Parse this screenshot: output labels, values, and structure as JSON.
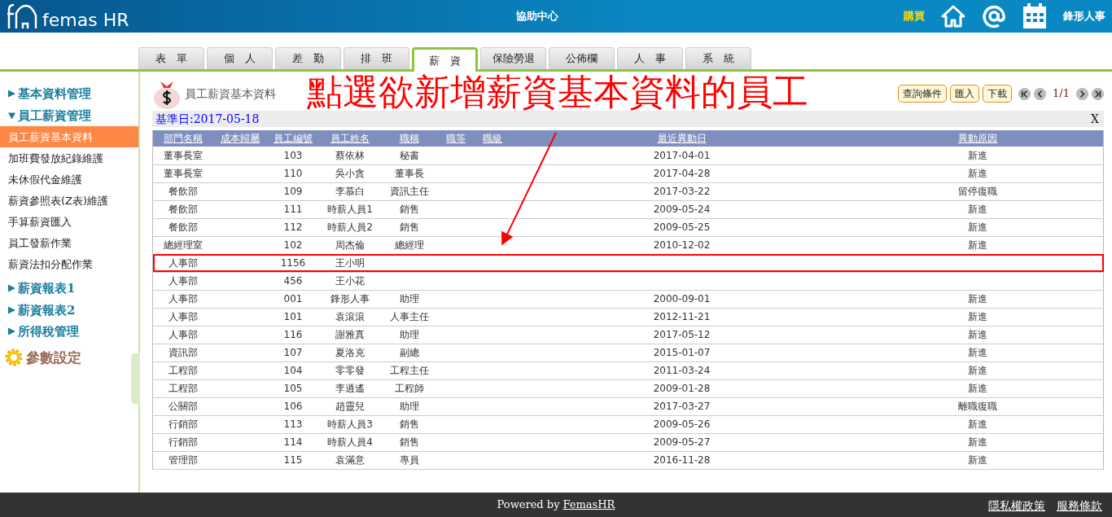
{
  "header": {
    "brand": "femas HR",
    "help": "協助中心",
    "buy": "購買",
    "user": "鋒形人事"
  },
  "tabs": [
    {
      "label": "表　單",
      "selected": false
    },
    {
      "label": "個　人",
      "selected": false
    },
    {
      "label": "差　勤",
      "selected": false
    },
    {
      "label": "排　班",
      "selected": false
    },
    {
      "label": "薪　資",
      "selected": true
    },
    {
      "label": "保險勞退",
      "selected": false
    },
    {
      "label": "公佈欄",
      "selected": false
    },
    {
      "label": "人　事",
      "selected": false
    },
    {
      "label": "系　統",
      "selected": false
    }
  ],
  "sidebar": {
    "sections": [
      {
        "label": "基本資料管理",
        "kind": "group",
        "expanded": false
      },
      {
        "label": "員工薪資管理",
        "kind": "group",
        "expanded": true,
        "items": [
          {
            "label": "員工薪資基本資料",
            "selected": true
          },
          {
            "label": "加班費發放紀錄維護",
            "selected": false
          },
          {
            "label": "未休假代金維護",
            "selected": false
          },
          {
            "label": "薪資參照表(Z表)維護",
            "selected": false
          },
          {
            "label": "手算薪資匯入",
            "selected": false
          },
          {
            "label": "員工發薪作業",
            "selected": false
          },
          {
            "label": "薪資法扣分配作業",
            "selected": false
          }
        ]
      },
      {
        "label": "薪資報表1",
        "kind": "group",
        "expanded": false
      },
      {
        "label": "薪資報表2",
        "kind": "group",
        "expanded": false
      },
      {
        "label": "所得稅管理",
        "kind": "group",
        "expanded": false
      },
      {
        "label": "參數設定",
        "kind": "settings"
      }
    ]
  },
  "page": {
    "title": "員工薪資基本資料",
    "annotation": "點選欲新增薪資基本資料的員工",
    "base_date_label": "基準日",
    "base_date": ":2017-05-18",
    "buttons": [
      "查詢條件",
      "匯入",
      "下載"
    ],
    "pager": "1/1",
    "close": "X"
  },
  "table": {
    "columns": [
      "部門名稱",
      "成本歸屬",
      "員工編號",
      "員工姓名",
      "職稱",
      "職等",
      "職級",
      "最近異動日",
      "異動原因"
    ],
    "rows": [
      {
        "cells": [
          "董事長室",
          "",
          "103",
          "蔡依林",
          "秘書",
          "",
          "",
          "2017-04-01",
          "新進"
        ],
        "highlighted": false
      },
      {
        "cells": [
          "董事長室",
          "",
          "110",
          "吳小貪",
          "董事長",
          "",
          "",
          "2017-04-28",
          "新進"
        ],
        "highlighted": false
      },
      {
        "cells": [
          "餐飲部",
          "",
          "109",
          "李慕白",
          "資訊主任",
          "",
          "",
          "2017-03-22",
          "留停復職"
        ],
        "highlighted": false
      },
      {
        "cells": [
          "餐飲部",
          "",
          "111",
          "時薪人員1",
          "銷售",
          "",
          "",
          "2009-05-24",
          "新進"
        ],
        "highlighted": false
      },
      {
        "cells": [
          "餐飲部",
          "",
          "112",
          "時薪人員2",
          "銷售",
          "",
          "",
          "2009-05-25",
          "新進"
        ],
        "highlighted": false
      },
      {
        "cells": [
          "總經理室",
          "",
          "102",
          "周杰倫",
          "總經理",
          "",
          "",
          "2010-12-02",
          "新進"
        ],
        "highlighted": false
      },
      {
        "cells": [
          "人事部",
          "",
          "1156",
          "王小明",
          "",
          "",
          "",
          "",
          ""
        ],
        "highlighted": true
      },
      {
        "cells": [
          "人事部",
          "",
          "456",
          "王小花",
          "",
          "",
          "",
          "",
          ""
        ],
        "highlighted": false
      },
      {
        "cells": [
          "人事部",
          "",
          "001",
          "鋒形人事",
          "助理",
          "",
          "",
          "2000-09-01",
          "新進"
        ],
        "highlighted": false
      },
      {
        "cells": [
          "人事部",
          "",
          "101",
          "袁滾滾",
          "人事主任",
          "",
          "",
          "2012-11-21",
          "新進"
        ],
        "highlighted": false
      },
      {
        "cells": [
          "人事部",
          "",
          "116",
          "謝雅真",
          "助理",
          "",
          "",
          "2017-05-12",
          "新進"
        ],
        "highlighted": false
      },
      {
        "cells": [
          "資訊部",
          "",
          "107",
          "夏洛克",
          "副總",
          "",
          "",
          "2015-01-07",
          "新進"
        ],
        "highlighted": false
      },
      {
        "cells": [
          "工程部",
          "",
          "104",
          "零零發",
          "工程主任",
          "",
          "",
          "2011-03-24",
          "新進"
        ],
        "highlighted": false
      },
      {
        "cells": [
          "工程部",
          "",
          "105",
          "李逍遙",
          "工程師",
          "",
          "",
          "2009-01-28",
          "新進"
        ],
        "highlighted": false
      },
      {
        "cells": [
          "公關部",
          "",
          "106",
          "趙靈兒",
          "助理",
          "",
          "",
          "2017-03-27",
          "離職復職"
        ],
        "highlighted": false
      },
      {
        "cells": [
          "行銷部",
          "",
          "113",
          "時薪人員3",
          "銷售",
          "",
          "",
          "2009-05-26",
          "新進"
        ],
        "highlighted": false
      },
      {
        "cells": [
          "行銷部",
          "",
          "114",
          "時薪人員4",
          "銷售",
          "",
          "",
          "2009-05-27",
          "新進"
        ],
        "highlighted": false
      },
      {
        "cells": [
          "管理部",
          "",
          "115",
          "袁滿意",
          "專員",
          "",
          "",
          "2016-11-28",
          "新進"
        ],
        "highlighted": false
      }
    ]
  },
  "footer": {
    "powered": "Powered by",
    "link": "FemasHR",
    "links": [
      "隱私權政策",
      "服務條款"
    ]
  }
}
